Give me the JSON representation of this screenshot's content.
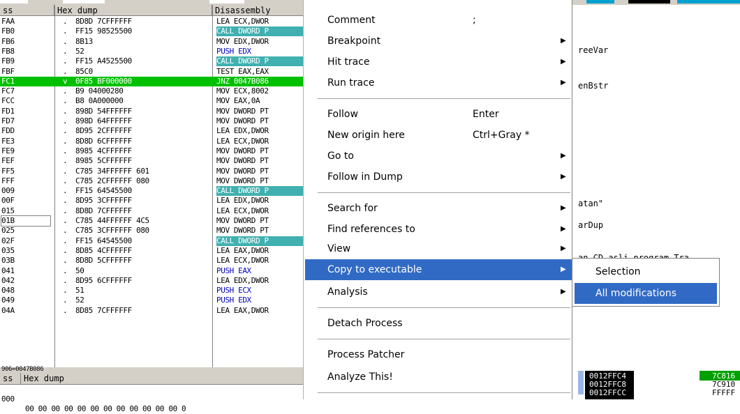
{
  "colors": {
    "accent": "#316ac5",
    "current_line": "#00c000",
    "call_highlight": "#40b0b0",
    "push_text": "#0000c0"
  },
  "cpu": {
    "headers": {
      "address": "ss",
      "hex": "Hex dump",
      "disasm": "Disassembly"
    },
    "rows": [
      {
        "addr": "FAA",
        "dot": ".",
        "hex": "8D8D 7CFFFFFF",
        "dis": "LEA ECX,DWOR",
        "style": ""
      },
      {
        "addr": "FB0",
        "dot": ".",
        "hex": "FF15 98525500",
        "dis": "CALL DWORD P",
        "style": "call"
      },
      {
        "addr": "FB6",
        "dot": ".",
        "hex": "8B13",
        "dis": "MOV EDX,DWOR",
        "style": ""
      },
      {
        "addr": "FB8",
        "dot": ".",
        "hex": "52",
        "dis": "PUSH EDX",
        "style": "push"
      },
      {
        "addr": "FB9",
        "dot": ".",
        "hex": "FF15 A4525500",
        "dis": "CALL DWORD P",
        "style": "call"
      },
      {
        "addr": "FBF",
        "dot": ".",
        "hex": "85C0",
        "dis": "TEST EAX,EAX",
        "style": ""
      },
      {
        "addr": "FC1",
        "dot": "v",
        "hex": "0F85 BF000000",
        "dis": "JNZ 0047B086",
        "style": "sel"
      },
      {
        "addr": "FC7",
        "dot": ".",
        "hex": "B9 04000280",
        "dis": "MOV ECX,8002",
        "style": ""
      },
      {
        "addr": "FCC",
        "dot": ".",
        "hex": "B8 0A000000",
        "dis": "MOV EAX,0A",
        "style": ""
      },
      {
        "addr": "FD1",
        "dot": ".",
        "hex": "898D 54FFFFFF",
        "dis": "MOV DWORD PT",
        "style": ""
      },
      {
        "addr": "FD7",
        "dot": ".",
        "hex": "898D 64FFFFFF",
        "dis": "MOV DWORD PT",
        "style": ""
      },
      {
        "addr": "FDD",
        "dot": ".",
        "hex": "8D95 2CFFFFFF",
        "dis": "LEA EDX,DWOR",
        "style": ""
      },
      {
        "addr": "FE3",
        "dot": ".",
        "hex": "8D8D 6CFFFFFF",
        "dis": "LEA ECX,DWOR",
        "style": ""
      },
      {
        "addr": "FE9",
        "dot": ".",
        "hex": "8985 4CFFFFFF",
        "dis": "MOV DWORD PT",
        "style": ""
      },
      {
        "addr": "FEF",
        "dot": ".",
        "hex": "8985 5CFFFFFF",
        "dis": "MOV DWORD PT",
        "style": ""
      },
      {
        "addr": "FF5",
        "dot": ".",
        "hex": "C785 34FFFFFF 601",
        "dis": "MOV DWORD PT",
        "style": ""
      },
      {
        "addr": "FFF",
        "dot": ".",
        "hex": "C785 2CFFFFFF 080",
        "dis": "MOV DWORD PT",
        "style": ""
      },
      {
        "addr": "009",
        "dot": ".",
        "hex": "FF15 64545500",
        "dis": "CALL DWORD P",
        "style": "call"
      },
      {
        "addr": "00F",
        "dot": ".",
        "hex": "8D95 3CFFFFFF",
        "dis": "LEA EDX,DWOR",
        "style": ""
      },
      {
        "addr": "015",
        "dot": ".",
        "hex": "8D8D 7CFFFFFF",
        "dis": "LEA ECX,DWOR",
        "style": ""
      },
      {
        "addr": "01B",
        "dot": ".",
        "hex": "C785 44FFFFFF 4C5",
        "dis": "MOV DWORD PT",
        "style": "",
        "addrhl": true
      },
      {
        "addr": "025",
        "dot": ".",
        "hex": "C785 3CFFFFFF 080",
        "dis": "MOV DWORD PT",
        "style": ""
      },
      {
        "addr": "02F",
        "dot": ".",
        "hex": "FF15 64545500",
        "dis": "CALL DWORD P",
        "style": "call"
      },
      {
        "addr": "035",
        "dot": ".",
        "hex": "8D85 4CFFFFFF",
        "dis": "LEA EAX,DWOR",
        "style": ""
      },
      {
        "addr": "03B",
        "dot": ".",
        "hex": "8D8D 5CFFFFFF",
        "dis": "LEA ECX,DWOR",
        "style": ""
      },
      {
        "addr": "041",
        "dot": ".",
        "hex": "50",
        "dis": "PUSH EAX",
        "style": "push"
      },
      {
        "addr": "042",
        "dot": ".",
        "hex": "8D95 6CFFFFFF",
        "dis": "LEA EDX,DWOR",
        "style": ""
      },
      {
        "addr": "048",
        "dot": ".",
        "hex": "51",
        "dis": "PUSH ECX",
        "style": "push"
      },
      {
        "addr": "049",
        "dot": ".",
        "hex": "52",
        "dis": "PUSH EDX",
        "style": "push"
      },
      {
        "addr": "04A",
        "dot": ".",
        "hex": "8D85 7CFFFFFF",
        "dis": "LEA EAX,DWOR",
        "style": ""
      }
    ],
    "status": "906=0047B086"
  },
  "comments": [
    {
      "text": "reeVar"
    },
    {
      "text": "enBstr"
    },
    {
      "text": "atan\""
    },
    {
      "text": "arDup"
    },
    {
      "text": "an CD asli program Tra"
    }
  ],
  "menu": {
    "items": [
      {
        "label": "Comment",
        "shortcut": ";",
        "arrow": ""
      },
      {
        "label": "Breakpoint",
        "shortcut": "",
        "arrow": "▶"
      },
      {
        "label": "Hit trace",
        "shortcut": "",
        "arrow": "▶"
      },
      {
        "label": "Run trace",
        "shortcut": "",
        "arrow": "▶"
      },
      {
        "label": "Follow",
        "shortcut": "Enter",
        "arrow": ""
      },
      {
        "label": "New origin here",
        "shortcut": "Ctrl+Gray *",
        "arrow": ""
      },
      {
        "label": "Go to",
        "shortcut": "",
        "arrow": "▶"
      },
      {
        "label": "Follow in Dump",
        "shortcut": "",
        "arrow": "▶"
      },
      {
        "label": "Search for",
        "shortcut": "",
        "arrow": "▶"
      },
      {
        "label": "Find references to",
        "shortcut": "",
        "arrow": "▶"
      },
      {
        "label": "View",
        "shortcut": "",
        "arrow": "▶"
      },
      {
        "label": "Copy to executable",
        "shortcut": "",
        "arrow": "▶"
      },
      {
        "label": "Analysis",
        "shortcut": "",
        "arrow": "▶"
      },
      {
        "label": "Detach Process",
        "shortcut": "",
        "arrow": ""
      },
      {
        "label": "Process Patcher",
        "shortcut": "",
        "arrow": ""
      },
      {
        "label": "Analyze This!",
        "shortcut": "",
        "arrow": ""
      }
    ]
  },
  "submenu": {
    "items": [
      {
        "label": "Selection"
      },
      {
        "label": "All modifications"
      }
    ]
  },
  "dump": {
    "headers": {
      "address": "ss",
      "hex": "Hex dump"
    },
    "row": {
      "addr": "000",
      "hex": "00 00 00 00 00 00 00 00 00 00 00 00 0"
    }
  },
  "stack": {
    "rows": [
      {
        "addr": "0012FFC4",
        "val": "7C816"
      },
      {
        "addr": "0012FFC8",
        "val": "7C910"
      },
      {
        "addr": "0012FFCC",
        "val": "FFFFF"
      }
    ]
  }
}
